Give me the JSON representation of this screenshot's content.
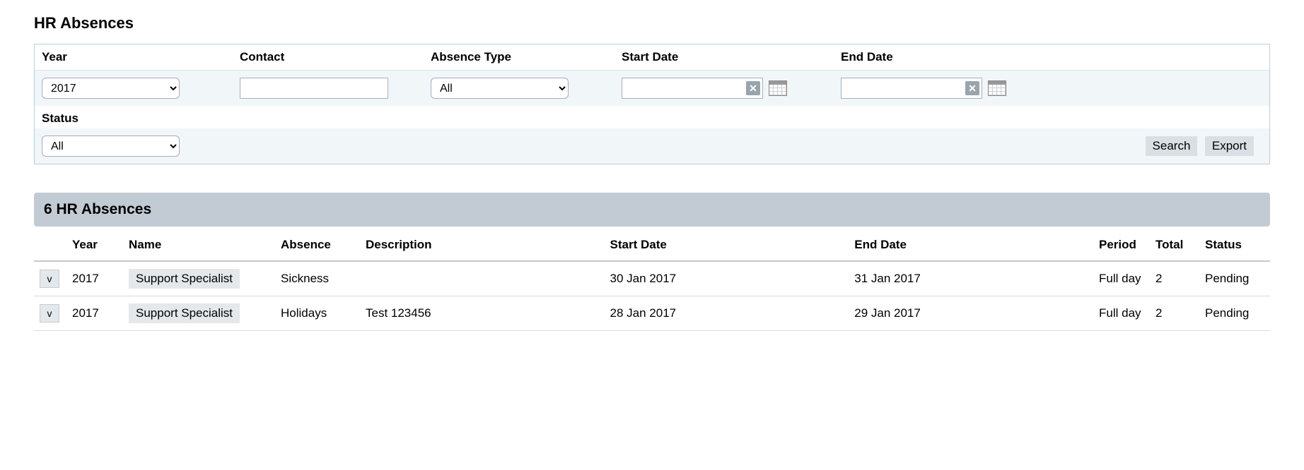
{
  "page_title": "HR Absences",
  "filters": {
    "year": {
      "label": "Year",
      "value": "2017"
    },
    "contact": {
      "label": "Contact",
      "value": ""
    },
    "absence_type": {
      "label": "Absence Type",
      "value": "All"
    },
    "start_date": {
      "label": "Start Date",
      "value": ""
    },
    "end_date": {
      "label": "End Date",
      "value": ""
    },
    "status": {
      "label": "Status",
      "value": "All"
    }
  },
  "actions": {
    "search": "Search",
    "export": "Export"
  },
  "results": {
    "header": "6 HR Absences",
    "columns": {
      "year": "Year",
      "name": "Name",
      "absence": "Absence",
      "description": "Description",
      "start_date": "Start Date",
      "end_date": "End Date",
      "period": "Period",
      "total": "Total",
      "status": "Status"
    },
    "rows": [
      {
        "toggle": "v",
        "year": "2017",
        "name": "Support Specialist",
        "absence": "Sickness",
        "description": "",
        "start_date": "30 Jan 2017",
        "end_date": "31 Jan 2017",
        "period": "Full day",
        "total": "2",
        "status": "Pending"
      },
      {
        "toggle": "v",
        "year": "2017",
        "name": "Support Specialist",
        "absence": "Holidays",
        "description": "Test 123456",
        "start_date": "28 Jan 2017",
        "end_date": "29 Jan 2017",
        "period": "Full day",
        "total": "2",
        "status": "Pending"
      }
    ]
  }
}
